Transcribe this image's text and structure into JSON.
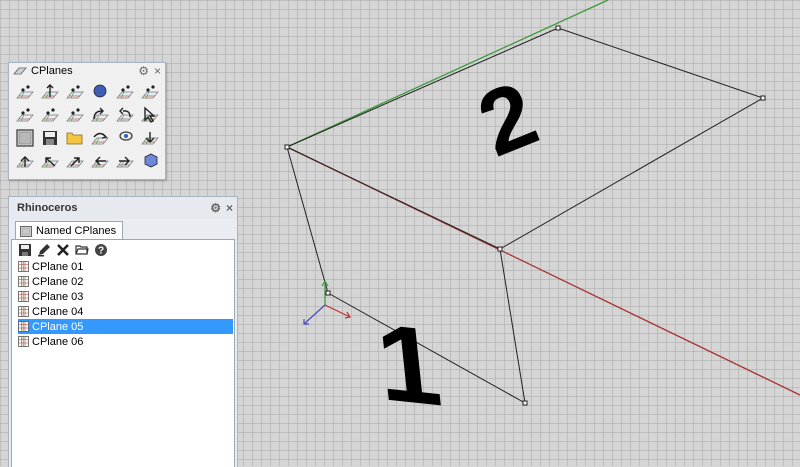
{
  "viewport": {
    "box_labels": {
      "front_face": "1",
      "top_face": "2"
    }
  },
  "cplanes_toolbar": {
    "title": "CPlanes",
    "settings_icon": "gear-icon",
    "close_label": "×",
    "tools": [
      "cplane-world-top-icon",
      "cplane-z-axis-icon",
      "cplane-to-object-icon",
      "cplane-sphere-icon",
      "cplane-perpendicular-icon",
      "cplane-3-point-icon",
      "cplane-origin-icon",
      "cplane-elevator-icon",
      "cplane-x-axis-icon",
      "cplane-rotate-icon",
      "cplane-undo-icon",
      "cplane-to-view-icon",
      "named-cplanes-icon",
      "save-cplane-icon",
      "open-cplane-icon",
      "cplane-rotate-x-icon",
      "cplane-view-icon",
      "cplane-arrow-down-icon",
      "cplane-arrow-up-icon",
      "cplane-arrow-back-icon",
      "cplane-arrow-forward-icon",
      "cplane-arrow-left-icon",
      "cplane-arrow-right-icon",
      "cplane-to-3d-icon"
    ]
  },
  "rhino_panel": {
    "title": "Rhinoceros",
    "close_label": "×",
    "tab_label": "Named CPlanes",
    "toolbar": [
      "save-icon",
      "edit-icon",
      "delete-icon",
      "open-folder-icon",
      "help-icon"
    ],
    "items": [
      {
        "label": "CPlane 01",
        "selected": false
      },
      {
        "label": "CPlane 02",
        "selected": false
      },
      {
        "label": "CPlane 03",
        "selected": false
      },
      {
        "label": "CPlane 04",
        "selected": false
      },
      {
        "label": "CPlane 05",
        "selected": true
      },
      {
        "label": "CPlane 06",
        "selected": false
      }
    ]
  },
  "colors": {
    "x_axis": "#a83232",
    "y_axis": "#3a9a3a",
    "selection": "#3399ff",
    "panel_border": "#a9b4c2"
  }
}
